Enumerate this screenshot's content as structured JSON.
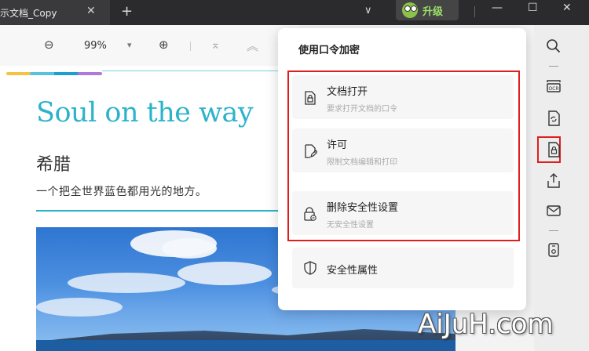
{
  "titlebar": {
    "tab_title": "示文档_Copy",
    "close_glyph": "✕",
    "new_tab_glyph": "+",
    "dropdown_glyph": "∨",
    "upgrade_label": "升级",
    "minimize_glyph": "—",
    "maximize_glyph": "☐",
    "window_close_glyph": "✕"
  },
  "toolbar": {
    "zoom_out_glyph": "⊖",
    "zoom_value": "99%",
    "zoom_dropdown_glyph": "▾",
    "zoom_in_glyph": "⊕",
    "first_page_glyph": "⌅",
    "prev_page_glyph": "︽"
  },
  "document": {
    "title": "Soul on the way",
    "subtitle": "希腊",
    "description": "一个把全世界蓝色都用光的地方。"
  },
  "security_panel": {
    "title": "使用口令加密",
    "options": [
      {
        "label": "文档打开",
        "description": "要求打开文档的口令",
        "icon": "lock-document-icon"
      },
      {
        "label": "许可",
        "description": "限制文档编辑和打印",
        "icon": "edit-document-icon"
      },
      {
        "label": "删除安全性设置",
        "description": "无安全性设置",
        "icon": "remove-lock-icon"
      },
      {
        "label": "安全性属性",
        "description": "",
        "icon": "shield-icon"
      }
    ]
  },
  "sidebar": {
    "icons": [
      "search-icon",
      "ocr-icon",
      "convert-icon",
      "security-icon",
      "share-icon",
      "mail-icon",
      "compress-icon"
    ],
    "ocr_text": "OCR"
  },
  "watermark": "AiJuH.com",
  "colors": {
    "accent": "#2cb3cc",
    "highlight_red": "#e01e1e",
    "upgrade_green": "#9be06a"
  }
}
